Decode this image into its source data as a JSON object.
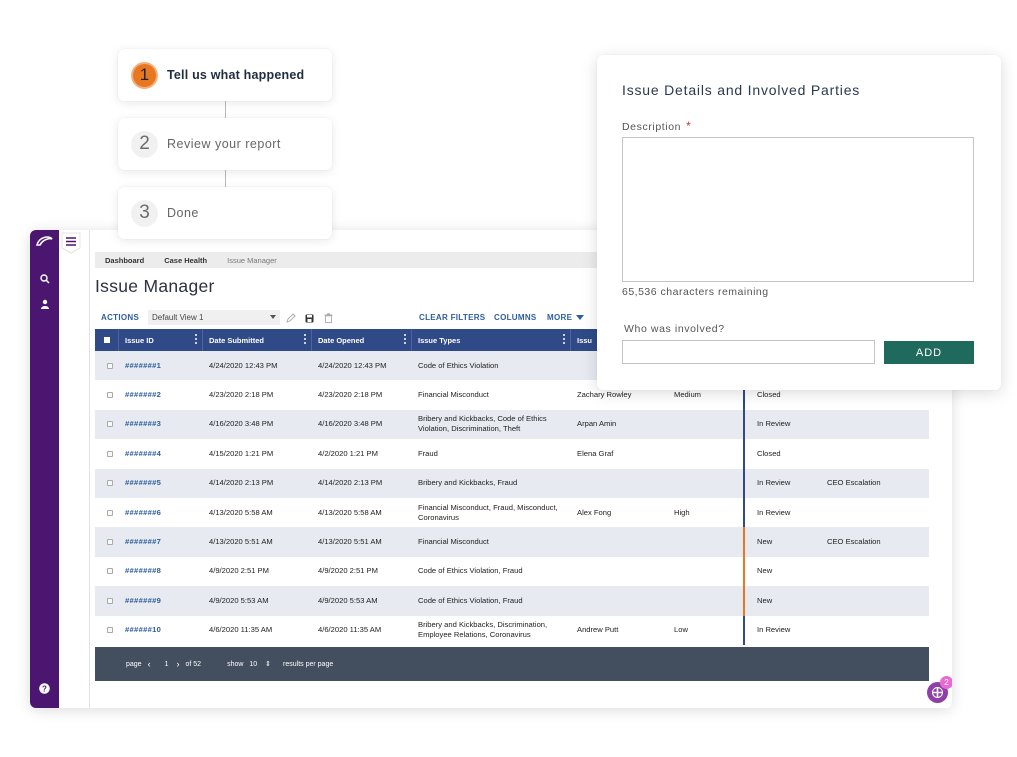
{
  "stepper": [
    {
      "number": "1",
      "label": "Tell us what happened",
      "state": "active"
    },
    {
      "number": "2",
      "label": "Review your report",
      "state": "inactive"
    },
    {
      "number": "3",
      "label": "Done",
      "state": "inactive"
    }
  ],
  "form": {
    "title": "Issue Details and Involved Parties",
    "description_label": "Description",
    "required_mark": "*",
    "description_value": "",
    "characters_remaining": "65,536 characters remaining",
    "who_label": "Who was involved?",
    "who_value": "",
    "add_label": "ADD"
  },
  "sidebar": {
    "icons": [
      "logo-icon",
      "search-icon",
      "user-icon",
      "help-icon"
    ]
  },
  "breadcrumb": [
    "Dashboard",
    "Case Health",
    "Issue Manager"
  ],
  "page_title": "Issue Manager",
  "toolbar": {
    "actions": "ACTIONS",
    "view": "Default View 1",
    "clear_filters": "CLEAR FILTERS",
    "columns": "COLUMNS",
    "more": "MORE"
  },
  "table": {
    "headers": [
      "Issue ID",
      "Date Submitted",
      "Date Opened",
      "Issue Types",
      "Issu"
    ],
    "rows": [
      {
        "id": "#######1",
        "submitted": "4/24/2020 12:43 PM",
        "opened": "4/24/2020 12:43 PM",
        "types": "Code of Ethics Violation",
        "person": "",
        "severity": "",
        "status": "",
        "escalation": "",
        "status_color": "#2f4a87"
      },
      {
        "id": "#######2",
        "submitted": "4/23/2020 2:18 PM",
        "opened": "4/23/2020 2:18 PM",
        "types": "Financial Misconduct",
        "person": "Zachary Rowley",
        "severity": "Medium",
        "status": "Closed",
        "escalation": "",
        "status_color": "#2f4a87"
      },
      {
        "id": "#######3",
        "submitted": "4/16/2020 3:48 PM",
        "opened": "4/16/2020 3:48 PM",
        "types": "Bribery and Kickbacks, Code of Ethics Violation, Discrimination, Theft",
        "person": "Arpan Amin",
        "severity": "",
        "status": "In Review",
        "escalation": "",
        "status_color": "#2f4a87"
      },
      {
        "id": "#######4",
        "submitted": "4/15/2020 1:21 PM",
        "opened": "4/2/2020 1:21 PM",
        "types": "Fraud",
        "person": "Elena Graf",
        "severity": "",
        "status": "Closed",
        "escalation": "",
        "status_color": "#2f4a87"
      },
      {
        "id": "#######5",
        "submitted": "4/14/2020 2:13 PM",
        "opened": "4/14/2020 2:13 PM",
        "types": "Bribery and Kickbacks, Fraud",
        "person": "",
        "severity": "",
        "status": "In Review",
        "escalation": "CEO Escalation",
        "status_color": "#2f4a87"
      },
      {
        "id": "#######6",
        "submitted": "4/13/2020 5:58 AM",
        "opened": "4/13/2020 5:58 AM",
        "types": "Financial Misconduct, Fraud, Misconduct, Coronavirus",
        "person": "Alex Fong",
        "severity": "High",
        "status": "In Review",
        "escalation": "",
        "status_color": "#2f4a87"
      },
      {
        "id": "#######7",
        "submitted": "4/13/2020 5:51 AM",
        "opened": "4/13/2020 5:51 AM",
        "types": "Financial Misconduct",
        "person": "",
        "severity": "",
        "status": "New",
        "escalation": "CEO Escalation",
        "status_color": "#e87722"
      },
      {
        "id": "#######8",
        "submitted": "4/9/2020 2:51 PM",
        "opened": "4/9/2020 2:51 PM",
        "types": "Code of Ethics Violation, Fraud",
        "person": "",
        "severity": "",
        "status": "New",
        "escalation": "",
        "status_color": "#e87722"
      },
      {
        "id": "#######9",
        "submitted": "4/9/2020 5:53 AM",
        "opened": "4/9/2020 5:53 AM",
        "types": "Code of Ethics Violation, Fraud",
        "person": "",
        "severity": "",
        "status": "New",
        "escalation": "",
        "status_color": "#e87722"
      },
      {
        "id": "######10",
        "submitted": "4/6/2020 11:35 AM",
        "opened": "4/6/2020 11:35 AM",
        "types": "Bribery and Kickbacks, Discrimination, Employee Relations, Coronavirus",
        "person": "Andrew Putt",
        "severity": "Low",
        "status": "In Review",
        "escalation": "",
        "status_color": "#2f4a87"
      }
    ]
  },
  "pagination": {
    "page_label": "page",
    "prev": "‹",
    "page": "1",
    "next": "›",
    "of_label": "of 52",
    "show_label": "show",
    "per_page": "10",
    "results_label": "results per page"
  },
  "fab": {
    "badge": "2"
  },
  "colors": {
    "sidebar": "#4a1670",
    "header": "#2f4a87",
    "accent": "#e87722",
    "add_button": "#1f6a5c",
    "footer": "#434f5e"
  }
}
